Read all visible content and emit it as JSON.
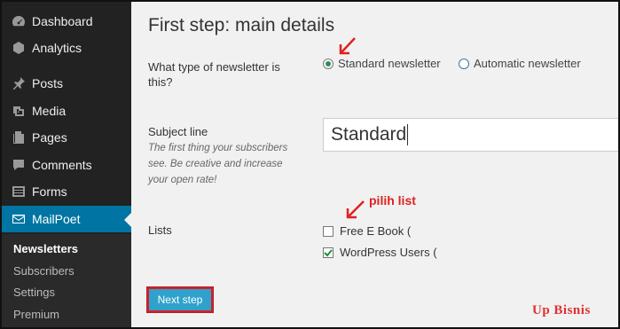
{
  "sidebar": {
    "items": [
      {
        "label": "Dashboard",
        "icon": "dashboard-icon"
      },
      {
        "label": "Analytics",
        "icon": "analytics-icon"
      },
      {
        "label": "Posts",
        "icon": "pin-icon"
      },
      {
        "label": "Media",
        "icon": "media-icon"
      },
      {
        "label": "Pages",
        "icon": "pages-icon"
      },
      {
        "label": "Comments",
        "icon": "comment-icon"
      },
      {
        "label": "Forms",
        "icon": "forms-icon"
      },
      {
        "label": "MailPoet",
        "icon": "envelope-icon",
        "active": true
      }
    ],
    "submenu": [
      "Newsletters",
      "Subscribers",
      "Settings",
      "Premium"
    ],
    "current_submenu": "Newsletters",
    "active_color": "#0074a2"
  },
  "main": {
    "heading": "First step: main details",
    "newsletter_type": {
      "label_line1": "What type of newsletter is",
      "label_line2": "this?",
      "options": [
        "Standard newsletter",
        "Automatic newsletter"
      ],
      "selected": "Standard newsletter"
    },
    "subject": {
      "label": "Subject line",
      "desc_lines": [
        "The first thing your subscribers",
        "see. Be creative and increase",
        "your open rate!"
      ],
      "value": "Standard"
    },
    "lists": {
      "label": "Lists",
      "items": [
        {
          "label": "Free E Book (",
          "checked": false
        },
        {
          "label": "WordPress Users (",
          "checked": true
        }
      ]
    },
    "next_button": "Next step"
  },
  "annotations": {
    "pilih_list": "pilih list",
    "watermark": "Up Bisnis",
    "color": "#e02020"
  }
}
